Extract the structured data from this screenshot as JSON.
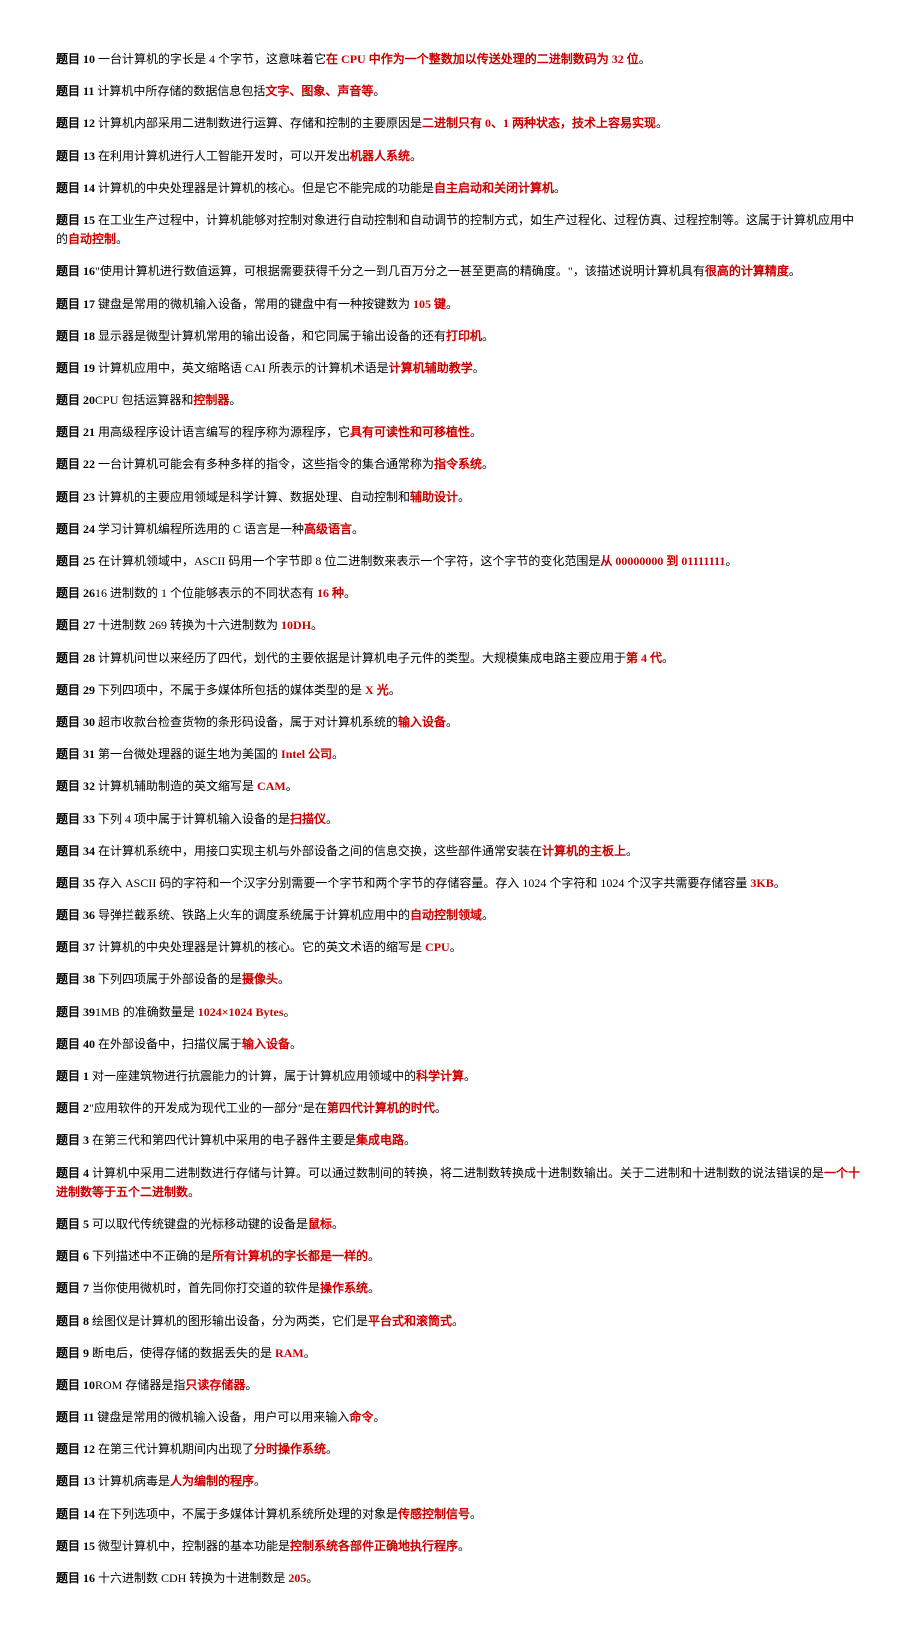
{
  "items": [
    {
      "label": "题目 10",
      "p1": " 一台计算机的字长是 4 个字节，这意味着它",
      "r1": "在 CPU 中作为一个整数加以传送处理的二进制数码为 32 位",
      "p2": "。"
    },
    {
      "label": "题目 11",
      "p1": " 计算机中所存储的数据信息包括",
      "r1": "文字、图象、声音等",
      "p2": "。"
    },
    {
      "label": "题目 12",
      "p1": " 计算机内部采用二进制数进行运算、存储和控制的主要原因是",
      "r1": "二进制只有 0、1 两种状态，技术上容易实现",
      "p2": "。"
    },
    {
      "label": "题目 13",
      "p1": " 在利用计算机进行人工智能开发时，可以开发出",
      "r1": "机器人系统",
      "p2": "。"
    },
    {
      "label": "题目 14",
      "p1": " 计算机的中央处理器是计算机的核心。但是它不能完成的功能是",
      "r1": "自主启动和关闭计算机",
      "p2": "。"
    },
    {
      "label": "题目 15",
      "p1": " 在工业生产过程中，计算机能够对控制对象进行自动控制和自动调节的控制方式，如生产过程化、过程仿真、过程控制等。这属于计算机应用中的",
      "r1": "自动控制",
      "p2": "。"
    },
    {
      "label": "题目 16",
      "p1": "\"使用计算机进行数值运算，可根据需要获得千分之一到几百万分之一甚至更高的精确度。\"，该描述说明计算机具有",
      "r1": "很高的计算精度",
      "p2": "。"
    },
    {
      "label": "题目 17",
      "p1": " 键盘是常用的微机输入设备，常用的键盘中有一种按键数为",
      "r1": " 105 键",
      "p2": "。"
    },
    {
      "label": "题目 18",
      "p1": " 显示器是微型计算机常用的输出设备，和它同属于输出设备的还有",
      "r1": "打印机",
      "p2": "。"
    },
    {
      "label": "题目 19",
      "p1": " 计算机应用中，英文缩略语 CAI 所表示的计算机术语是",
      "r1": "计算机辅助教学",
      "p2": "。"
    },
    {
      "label": "题目 20",
      "p1": "CPU 包括运算器和",
      "r1": "控制器",
      "p2": "。"
    },
    {
      "label": "题目 21",
      "p1": " 用高级程序设计语言编写的程序称为源程序，它",
      "r1": "具有可读性和可移植性",
      "p2": "。"
    },
    {
      "label": "题目 22",
      "p1": " 一台计算机可能会有多种多样的指令，这些指令的集合通常称为",
      "r1": "指令系统",
      "p2": "。"
    },
    {
      "label": "题目 23",
      "p1": " 计算机的主要应用领域是科学计算、数据处理、自动控制和",
      "r1": "辅助设计",
      "p2": "。"
    },
    {
      "label": "题目 24",
      "p1": " 学习计算机编程所选用的 C 语言是一种",
      "r1": "高级语言",
      "p2": "。"
    },
    {
      "label": "题目 25",
      "p1": " 在计算机领域中，ASCII 码用一个字节即 8 位二进制数来表示一个字符，这个字节的变化范围是",
      "r1": "从 00000000 到 01111111",
      "p2": "。"
    },
    {
      "label": "题目 26",
      "p1": "16 进制数的 1 个位能够表示的不同状态有",
      "r1": " 16 种",
      "p2": "。"
    },
    {
      "label": "题目 27",
      "p1": " 十进制数 269 转换为十六进制数为",
      "r1": " 10DH",
      "p2": "。"
    },
    {
      "label": "题目 28",
      "p1": " 计算机问世以来经历了四代，划代的主要依据是计算机电子元件的类型。大规模集成电路主要应用于",
      "r1": "第 4 代",
      "p2": "。"
    },
    {
      "label": "题目 29",
      "p1": " 下列四项中，不属于多媒体所包括的媒体类型的是",
      "r1": " X 光",
      "p2": "。"
    },
    {
      "label": "题目 30",
      "p1": " 超市收款台检查货物的条形码设备，属于对计算机系统的",
      "r1": "输入设备",
      "p2": "。"
    },
    {
      "label": "题目 31",
      "p1": " 第一台微处理器的诞生地为美国的",
      "r1": " Intel 公司",
      "p2": "。"
    },
    {
      "label": "题目 32",
      "p1": " 计算机辅助制造的英文缩写是",
      "r1": " CAM",
      "p2": "。"
    },
    {
      "label": "题目 33",
      "p1": " 下列 4 项中属于计算机输入设备的是",
      "r1": "扫描仪",
      "p2": "。"
    },
    {
      "label": "题目 34",
      "p1": " 在计算机系统中，用接口实现主机与外部设备之间的信息交换，这些部件通常安装在",
      "r1": "计算机的主板上",
      "p2": "。"
    },
    {
      "label": "题目 35",
      "p1": " 存入 ASCII 码的字符和一个汉字分别需要一个字节和两个字节的存储容量。存入 1024 个字符和 1024 个汉字共需要存储容量",
      "r1": " 3KB",
      "p2": "。"
    },
    {
      "label": "题目 36",
      "p1": " 导弹拦截系统、铁路上火车的调度系统属于计算机应用中的",
      "r1": "自动控制领域",
      "p2": "。"
    },
    {
      "label": "题目 37",
      "p1": " 计算机的中央处理器是计算机的核心。它的英文术语的缩写是",
      "r1": " CPU",
      "p2": "。"
    },
    {
      "label": "题目 38",
      "p1": " 下列四项属于外部设备的是",
      "r1": "摄像头",
      "p2": "。"
    },
    {
      "label": "题目 39",
      "p1": "1MB 的准确数量是",
      "r1": " 1024×1024 Bytes",
      "p2": "。"
    },
    {
      "label": "题目 40",
      "p1": " 在外部设备中，扫描仪属于",
      "r1": "输入设备",
      "p2": "。"
    },
    {
      "label": "题目 1",
      "p1": " 对一座建筑物进行抗震能力的计算，属于计算机应用领域中的",
      "r1": "科学计算",
      "p2": "。"
    },
    {
      "label": "题目 2",
      "p1": "\"应用软件的开发成为现代工业的一部分\"是在",
      "r1": "第四代计算机的时代",
      "p2": "。"
    },
    {
      "label": "题目 3",
      "p1": " 在第三代和第四代计算机中采用的电子器件主要是",
      "r1": "集成电路",
      "p2": "。"
    },
    {
      "label": "题目 4",
      "p1": " 计算机中采用二进制数进行存储与计算。可以通过数制间的转换，将二进制数转换成十进制数输出。关于二进制和十进制数的说法错误的是",
      "r1": "一个十进制数等于五个二进制数",
      "p2": "。"
    },
    {
      "label": "题目 5",
      "p1": " 可以取代传统键盘的光标移动键的设备是",
      "r1": "鼠标",
      "p2": "。"
    },
    {
      "label": "题目 6",
      "p1": " 下列描述中不正确的是",
      "r1": "所有计算机的字长都是一样的",
      "p2": "。"
    },
    {
      "label": "题目 7",
      "p1": " 当你使用微机时，首先同你打交道的软件是",
      "r1": "操作系统",
      "p2": "。"
    },
    {
      "label": "题目 8",
      "p1": " 绘图仪是计算机的图形输出设备，分为两类，它们是",
      "r1": "平台式和滚筒式",
      "p2": "。"
    },
    {
      "label": "题目 9",
      "p1": " 断电后，使得存储的数据丢失的是",
      "r1": " RAM",
      "p2": "。"
    },
    {
      "label": "题目 10",
      "p1": "ROM 存储器是指",
      "r1": "只读存储器",
      "p2": "。"
    },
    {
      "label": "题目 11",
      "p1": " 键盘是常用的微机输入设备，用户可以用来输入",
      "r1": "命令",
      "p2": "。"
    },
    {
      "label": "题目 12",
      "p1": " 在第三代计算机期间内出现了",
      "r1": "分时操作系统",
      "p2": "。"
    },
    {
      "label": "题目 13",
      "p1": " 计算机病毒是",
      "r1": "人为编制的程序",
      "p2": "。"
    },
    {
      "label": "题目 14",
      "p1": " 在下列选项中，不属于多媒体计算机系统所处理的对象是",
      "r1": "传感控制信号",
      "p2": "。"
    },
    {
      "label": "题目 15",
      "p1": " 微型计算机中，控制器的基本功能是",
      "r1": "控制系统各部件正确地执行程序",
      "p2": "。"
    },
    {
      "label": "题目 16",
      "p1": " 十六进制数 CDH 转换为十进制数是",
      "r1": " 205",
      "p2": "。"
    }
  ]
}
